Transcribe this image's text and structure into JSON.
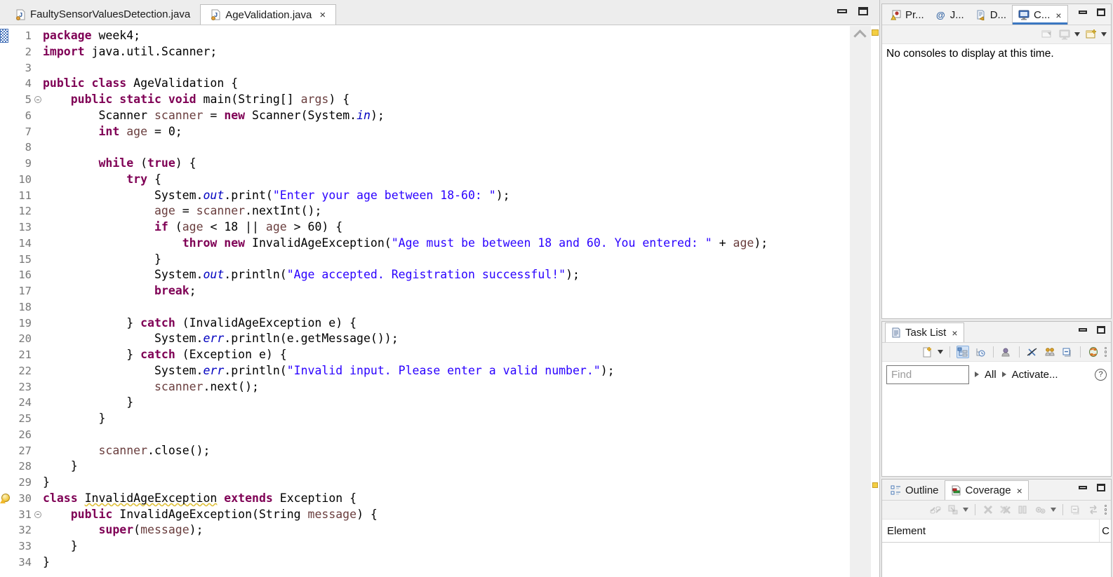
{
  "editor": {
    "tabs": [
      {
        "label": "FaultySensorValuesDetection.java",
        "active": false
      },
      {
        "label": "AgeValidation.java",
        "active": true,
        "close": "×"
      }
    ],
    "code_lines": [
      {
        "n": "1",
        "marker": "range",
        "tokens": [
          [
            "kw",
            "package"
          ],
          [
            "def",
            " week4;"
          ]
        ]
      },
      {
        "n": "2",
        "tokens": [
          [
            "kw",
            "import"
          ],
          [
            "def",
            " java.util.Scanner;"
          ]
        ]
      },
      {
        "n": "3",
        "tokens": []
      },
      {
        "n": "4",
        "tokens": [
          [
            "kw",
            "public"
          ],
          [
            "def",
            " "
          ],
          [
            "kw",
            "class"
          ],
          [
            "def",
            " AgeValidation {"
          ]
        ]
      },
      {
        "n": "5",
        "fold": true,
        "tokens": [
          [
            "def",
            "    "
          ],
          [
            "kw",
            "public"
          ],
          [
            "def",
            " "
          ],
          [
            "kw",
            "static"
          ],
          [
            "def",
            " "
          ],
          [
            "kw",
            "void"
          ],
          [
            "def",
            " main(String[] "
          ],
          [
            "var",
            "args"
          ],
          [
            "def",
            ") {"
          ]
        ]
      },
      {
        "n": "6",
        "tokens": [
          [
            "def",
            "        Scanner "
          ],
          [
            "var",
            "scanner"
          ],
          [
            "def",
            " = "
          ],
          [
            "kw",
            "new"
          ],
          [
            "def",
            " Scanner(System."
          ],
          [
            "sf",
            "in"
          ],
          [
            "def",
            ");"
          ]
        ]
      },
      {
        "n": "7",
        "tokens": [
          [
            "def",
            "        "
          ],
          [
            "kw",
            "int"
          ],
          [
            "def",
            " "
          ],
          [
            "var",
            "age"
          ],
          [
            "def",
            " = 0;"
          ]
        ]
      },
      {
        "n": "8",
        "tokens": []
      },
      {
        "n": "9",
        "tokens": [
          [
            "def",
            "        "
          ],
          [
            "kw",
            "while"
          ],
          [
            "def",
            " ("
          ],
          [
            "kw",
            "true"
          ],
          [
            "def",
            ") {"
          ]
        ]
      },
      {
        "n": "10",
        "tokens": [
          [
            "def",
            "            "
          ],
          [
            "kw",
            "try"
          ],
          [
            "def",
            " {"
          ]
        ]
      },
      {
        "n": "11",
        "tokens": [
          [
            "def",
            "                System."
          ],
          [
            "sf",
            "out"
          ],
          [
            "def",
            ".print("
          ],
          [
            "str",
            "\"Enter your age between 18-60: \""
          ],
          [
            "def",
            ");"
          ]
        ]
      },
      {
        "n": "12",
        "tokens": [
          [
            "def",
            "                "
          ],
          [
            "var",
            "age"
          ],
          [
            "def",
            " = "
          ],
          [
            "var",
            "scanner"
          ],
          [
            "def",
            ".nextInt();"
          ]
        ]
      },
      {
        "n": "13",
        "tokens": [
          [
            "def",
            "                "
          ],
          [
            "kw",
            "if"
          ],
          [
            "def",
            " ("
          ],
          [
            "var",
            "age"
          ],
          [
            "def",
            " < 18 || "
          ],
          [
            "var",
            "age"
          ],
          [
            "def",
            " > 60) {"
          ]
        ]
      },
      {
        "n": "14",
        "tokens": [
          [
            "def",
            "                    "
          ],
          [
            "kw",
            "throw"
          ],
          [
            "def",
            " "
          ],
          [
            "kw",
            "new"
          ],
          [
            "def",
            " InvalidAgeException("
          ],
          [
            "str",
            "\"Age must be between 18 and 60. You entered: \""
          ],
          [
            "def",
            " + "
          ],
          [
            "var",
            "age"
          ],
          [
            "def",
            ");"
          ]
        ]
      },
      {
        "n": "15",
        "tokens": [
          [
            "def",
            "                }"
          ]
        ]
      },
      {
        "n": "16",
        "tokens": [
          [
            "def",
            "                System."
          ],
          [
            "sf",
            "out"
          ],
          [
            "def",
            ".println("
          ],
          [
            "str",
            "\"Age accepted. Registration successful!\""
          ],
          [
            "def",
            ");"
          ]
        ]
      },
      {
        "n": "17",
        "tokens": [
          [
            "def",
            "                "
          ],
          [
            "kw",
            "break"
          ],
          [
            "def",
            ";"
          ]
        ]
      },
      {
        "n": "18",
        "tokens": []
      },
      {
        "n": "19",
        "tokens": [
          [
            "def",
            "            } "
          ],
          [
            "kw",
            "catch"
          ],
          [
            "def",
            " (InvalidAgeException e) {"
          ]
        ]
      },
      {
        "n": "20",
        "tokens": [
          [
            "def",
            "                System."
          ],
          [
            "sf",
            "err"
          ],
          [
            "def",
            ".println(e.getMessage());"
          ]
        ]
      },
      {
        "n": "21",
        "tokens": [
          [
            "def",
            "            } "
          ],
          [
            "kw",
            "catch"
          ],
          [
            "def",
            " (Exception e) {"
          ]
        ]
      },
      {
        "n": "22",
        "tokens": [
          [
            "def",
            "                System."
          ],
          [
            "sf",
            "err"
          ],
          [
            "def",
            ".println("
          ],
          [
            "str",
            "\"Invalid input. Please enter a valid number.\""
          ],
          [
            "def",
            ");"
          ]
        ]
      },
      {
        "n": "23",
        "tokens": [
          [
            "def",
            "                "
          ],
          [
            "var",
            "scanner"
          ],
          [
            "def",
            ".next();"
          ]
        ]
      },
      {
        "n": "24",
        "tokens": [
          [
            "def",
            "            }"
          ]
        ]
      },
      {
        "n": "25",
        "tokens": [
          [
            "def",
            "        }"
          ]
        ]
      },
      {
        "n": "26",
        "tokens": []
      },
      {
        "n": "27",
        "tokens": [
          [
            "def",
            "        "
          ],
          [
            "var",
            "scanner"
          ],
          [
            "def",
            ".close();"
          ]
        ]
      },
      {
        "n": "28",
        "tokens": [
          [
            "def",
            "    }"
          ]
        ]
      },
      {
        "n": "29",
        "tokens": [
          [
            "def",
            "}"
          ]
        ]
      },
      {
        "n": "30",
        "marker": "warning",
        "tokens": [
          [
            "kw",
            "class"
          ],
          [
            "def",
            " "
          ],
          [
            "warn",
            "InvalidAgeException"
          ],
          [
            "def",
            " "
          ],
          [
            "kw",
            "extends"
          ],
          [
            "def",
            " Exception {"
          ]
        ]
      },
      {
        "n": "31",
        "fold": true,
        "tokens": [
          [
            "def",
            "    "
          ],
          [
            "kw",
            "public"
          ],
          [
            "def",
            " InvalidAgeException(String "
          ],
          [
            "var",
            "message"
          ],
          [
            "def",
            ") {"
          ]
        ]
      },
      {
        "n": "32",
        "tokens": [
          [
            "def",
            "        "
          ],
          [
            "kw",
            "super"
          ],
          [
            "def",
            "("
          ],
          [
            "var",
            "message"
          ],
          [
            "def",
            ");"
          ]
        ]
      },
      {
        "n": "33",
        "tokens": [
          [
            "def",
            "    }"
          ]
        ]
      },
      {
        "n": "34",
        "tokens": [
          [
            "def",
            "}"
          ]
        ]
      }
    ],
    "syntax_colors": {
      "keyword": "#7f0055",
      "string": "#2a00ff",
      "static_field": "#0000c0",
      "local_variable": "#6a3e3e",
      "line_number": "#787878",
      "warning_underline": "#e0c23c"
    }
  },
  "console_view": {
    "tabs": [
      {
        "label": "Pr...",
        "icon": "problems-icon"
      },
      {
        "label": "J...",
        "icon": "javadoc-icon"
      },
      {
        "label": "D...",
        "icon": "declaration-icon"
      },
      {
        "label": "C...",
        "icon": "console-icon",
        "active": true,
        "close": "×"
      }
    ],
    "toolbar_icons": [
      "pin-console-icon",
      "display-selected-console-icon",
      "dropdown-arrow-icon",
      "open-console-icon",
      "dropdown-arrow-icon"
    ],
    "message": "No consoles to display at this time."
  },
  "task_list_view": {
    "title": "Task List",
    "close": "×",
    "toolbar_icons": [
      "new-task-icon",
      "dropdown-arrow-icon",
      "categorized-icon",
      "scheduled-icon",
      "person-icon",
      "hide-completed-icon",
      "people-filter-icon",
      "collapse-all-icon",
      "synchronize-icon",
      "view-menu-icon"
    ],
    "find_placeholder": "Find",
    "scope_all": "All",
    "scope_activate": "Activate...",
    "help": "?"
  },
  "outline_coverage_view": {
    "tabs": [
      {
        "label": "Outline",
        "icon": "outline-icon"
      },
      {
        "label": "Coverage",
        "icon": "coverage-icon",
        "active": true,
        "close": "×"
      }
    ],
    "toolbar_icons": [
      "link-with-editor-icon",
      "import-session-icon",
      "dropdown-arrow-icon",
      "remove-session-icon",
      "remove-all-sessions-icon",
      "columns-icon",
      "settings-icon",
      "dropdown-arrow-icon",
      "collapse-all-icon",
      "relaunch-session-icon",
      "view-menu-icon"
    ],
    "columns": {
      "element": "Element",
      "coverage": "C"
    }
  }
}
